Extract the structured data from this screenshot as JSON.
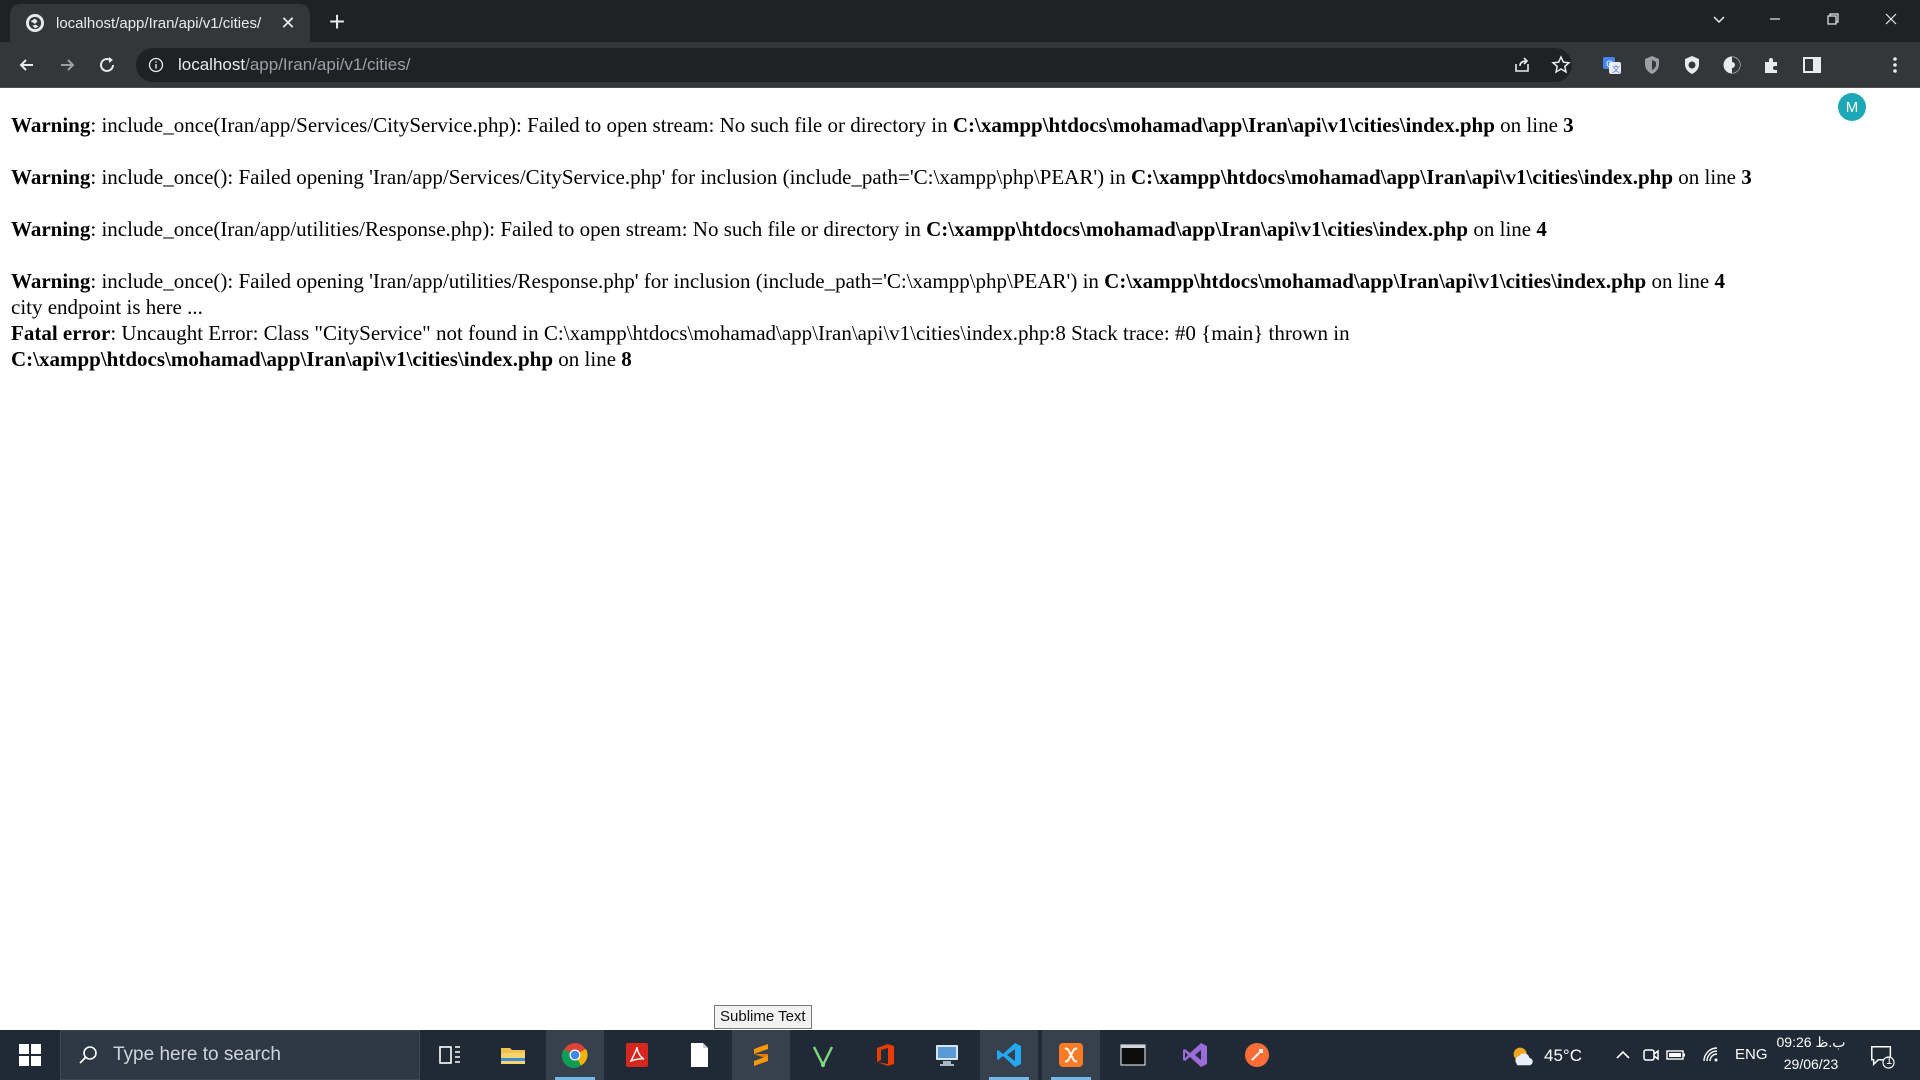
{
  "browser": {
    "tab_title": "localhost/app/Iran/api/v1/cities/",
    "url_host": "localhost",
    "url_path": "/app/Iran/api/v1/cities/",
    "profile_initial": "M"
  },
  "page": {
    "warnings": [
      {
        "label": "Warning",
        "message": ": include_once(Iran/app/Services/CityService.php): Failed to open stream: No such file or directory in ",
        "file": "C:\\xampp\\htdocs\\mohamad\\app\\Iran\\api\\v1\\cities\\index.php",
        "on_line": " on line ",
        "line": "3"
      },
      {
        "label": "Warning",
        "message": ": include_once(): Failed opening 'Iran/app/Services/CityService.php' for inclusion (include_path='C:\\xampp\\php\\PEAR') in ",
        "file": "C:\\xampp\\htdocs\\mohamad\\app\\Iran\\api\\v1\\cities\\index.php",
        "on_line": " on line ",
        "line": "3"
      },
      {
        "label": "Warning",
        "message": ": include_once(Iran/app/utilities/Response.php): Failed to open stream: No such file or directory in ",
        "file": "C:\\xampp\\htdocs\\mohamad\\app\\Iran\\api\\v1\\cities\\index.php",
        "on_line": " on line ",
        "line": "4"
      },
      {
        "label": "Warning",
        "message": ": include_once(): Failed opening 'Iran/app/utilities/Response.php' for inclusion (include_path='C:\\xampp\\php\\PEAR') in ",
        "file": "C:\\xampp\\htdocs\\mohamad\\app\\Iran\\api\\v1\\cities\\index.php",
        "on_line": " on line ",
        "line": "4"
      }
    ],
    "echo_line": "city endpoint is here ...",
    "fatal": {
      "label": "Fatal error",
      "message": ": Uncaught Error: Class \"CityService\" not found in C:\\xampp\\htdocs\\mohamad\\app\\Iran\\api\\v1\\cities\\index.php:8 Stack trace: #0 {main} thrown in",
      "file": "C:\\xampp\\htdocs\\mohamad\\app\\Iran\\api\\v1\\cities\\index.php",
      "on_line": " on line ",
      "line": "8"
    }
  },
  "tooltip": "Sublime Text",
  "taskbar": {
    "search_placeholder": "Type here to search",
    "temperature": "45°C",
    "language": "ENG",
    "time": "09:26 ب.ظ",
    "date": "29/06/23",
    "notification_count": "1"
  },
  "colors": {
    "tabstrip": "#202124",
    "toolbar": "#35363a",
    "taskbar": "#1f2a36",
    "profile": "#1da8b7"
  }
}
